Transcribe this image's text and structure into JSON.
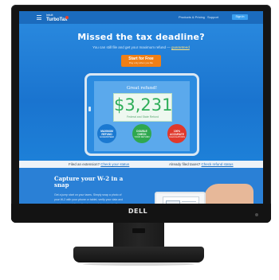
{
  "colors": {
    "hero_blue": "#1a74cf",
    "cta_orange": "#f07f15",
    "refund_green": "#2fae5a",
    "badge_blue": "#1b79d1",
    "badge_green": "#2fa84f",
    "badge_red": "#e0382b",
    "bezel": "#141414"
  },
  "nav": {
    "logo_small": "intuit",
    "logo": "TurboTax",
    "links": [
      "Products & Pricing",
      "Support",
      "Sign In"
    ],
    "signin_label": "Sign In"
  },
  "hero": {
    "headline": "Missed the tax deadline?",
    "subline_prefix": "You can still file and get your maximum refund — ",
    "subline_link": "guaranteed",
    "cta_main": "Start for Free",
    "cta_sub": "Pay only when you file"
  },
  "tablet": {
    "title": "Great refund!",
    "amount": "$3,231",
    "caption": "Federal and State Refund"
  },
  "badges": [
    {
      "title": "MAXIMUM REFUND",
      "sub": "GUARANTEED",
      "color": "#1b79d1"
    },
    {
      "title": "DOUBLE CHECK",
      "sub": "YOUR RETURN",
      "color": "#2fa84f"
    },
    {
      "title": "100% ACCURATE",
      "sub": "CALCULATIONS",
      "color": "#e0382b"
    }
  ],
  "status_bar": {
    "left_text": "Filed an extension? ",
    "left_link": "Check your status",
    "right_text": "Already filed taxes? ",
    "right_link": "Check refund status"
  },
  "capture": {
    "title": "Capture your W-2 in a snap",
    "body": "Get a jump start on your taxes. Simply snap a photo of your W-2 with your phone or tablet, verify your data and watch as your information is accurately and instantly..."
  },
  "monitor": {
    "brand": "DELL"
  },
  "icons": [
    "menu-icon",
    "turbotax-check-icon",
    "power-icon"
  ]
}
